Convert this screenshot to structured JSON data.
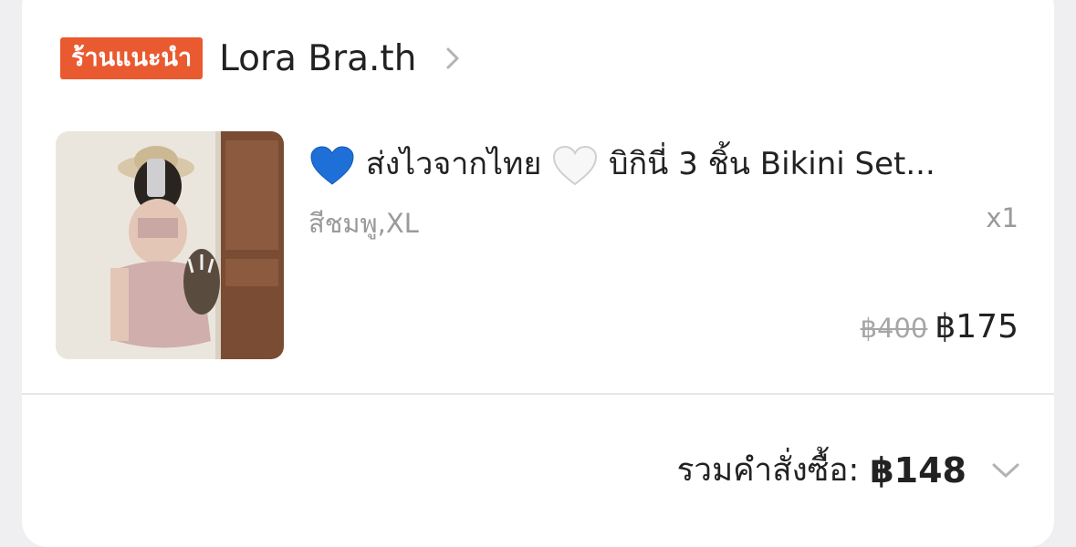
{
  "shop": {
    "badge": "ร้านแนะนำ",
    "name": "Lora Bra.th",
    "chevron_icon": "chevron-right-icon"
  },
  "product": {
    "title_part1": "ส่งไวจากไทย",
    "title_part2": "บิกินี่ 3 ชิ้น Bikini Set...",
    "icons": [
      "blue-heart-icon",
      "white-heart-icon"
    ],
    "variant": "สีชมพู,XL",
    "quantity": "x1",
    "original_price": "฿400",
    "sale_price": "฿175"
  },
  "order": {
    "total_label": "รวมคำสั่งซื้อ:",
    "total_value": "฿148",
    "expand_icon": "chevron-down-icon"
  },
  "colors": {
    "badge_bg": "#ea5a30",
    "text_primary": "#222222",
    "text_muted": "#9a9a9a",
    "heart_blue": "#1f6fd8"
  }
}
